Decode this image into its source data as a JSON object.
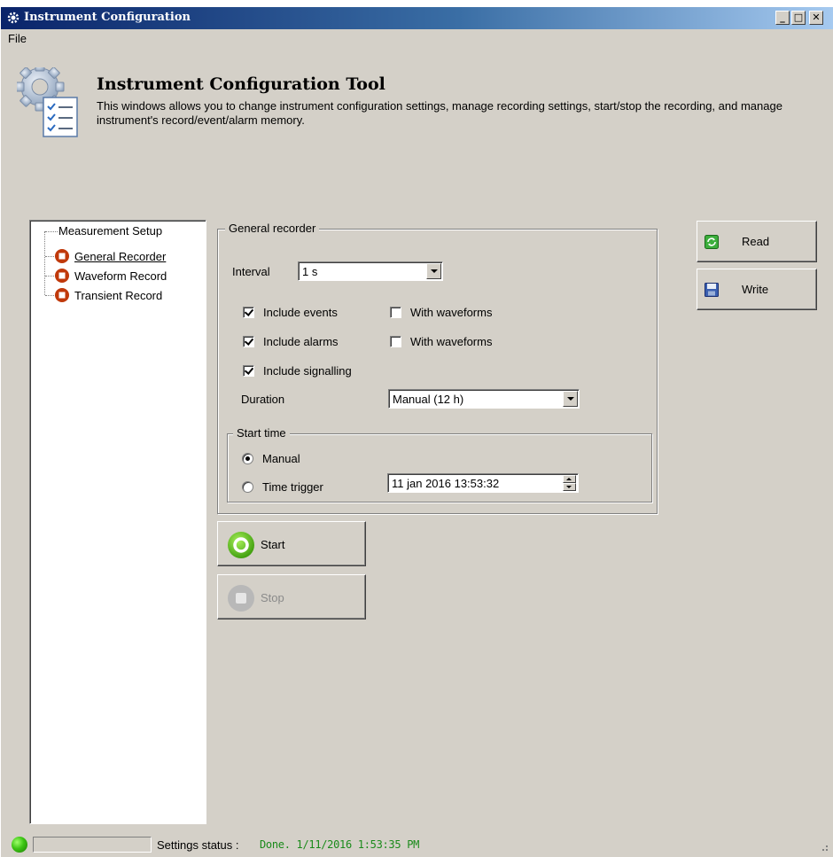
{
  "window": {
    "title": "Instrument Configuration",
    "min_label": "_",
    "max_label": "□",
    "close_label": "✕"
  },
  "menu": {
    "file": "File"
  },
  "header": {
    "title": "Instrument Configuration Tool",
    "description": "This windows allows you to change instrument configuration settings, manage recording settings, start/stop the recording, and manage instrument's record/event/alarm memory."
  },
  "tree": {
    "root": "Measurement Setup",
    "items": [
      {
        "label": "General Recorder",
        "selected": true
      },
      {
        "label": "Waveform Record",
        "selected": false
      },
      {
        "label": "Transient Record",
        "selected": false
      }
    ]
  },
  "general_recorder": {
    "legend": "General recorder",
    "interval_label": "Interval",
    "interval_value": "1 s",
    "include_events": "Include events",
    "include_alarms": "Include alarms",
    "include_signalling": "Include signalling",
    "with_waveforms_1": "With waveforms",
    "with_waveforms_2": "With waveforms",
    "duration_label": "Duration",
    "duration_value": "Manual (12 h)",
    "start_time": {
      "legend": "Start time",
      "manual": "Manual",
      "time_trigger": "Time trigger",
      "datetime": "11 jan  2016 13:53:32"
    }
  },
  "buttons": {
    "start": "Start",
    "stop": "Stop",
    "read": "Read",
    "write": "Write"
  },
  "status": {
    "label": "Settings status :",
    "value": "Done. 1/11/2016 1:53:35 PM"
  },
  "colors": {
    "titlebar": "#0a246a",
    "window_bg": "#d4d0c8",
    "start_green": "#5cc41a",
    "status_green": "#1a8a1a",
    "tree_icon_red": "#c0390b"
  }
}
